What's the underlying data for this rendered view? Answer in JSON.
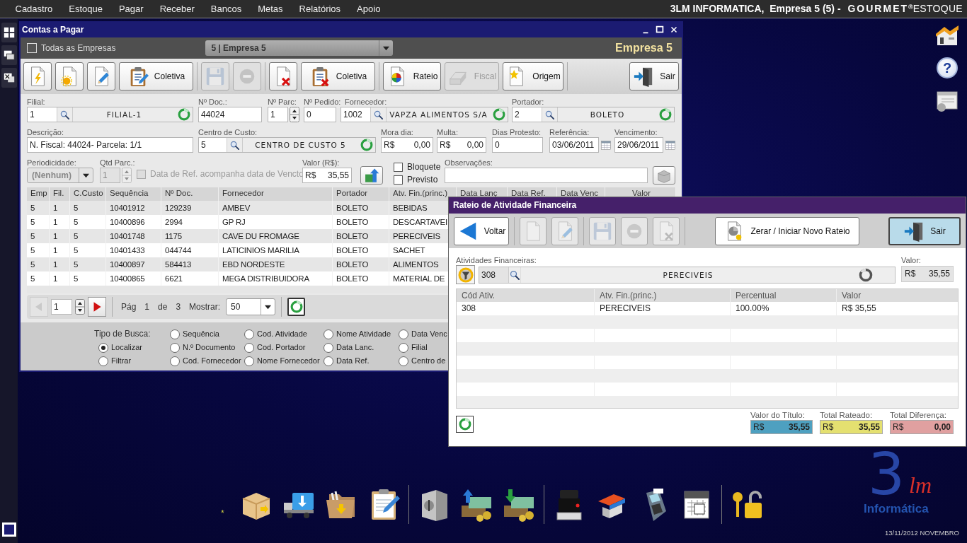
{
  "menu_bar": {
    "items": [
      "Cadastro",
      "Estoque",
      "Pagar",
      "Receber",
      "Bancos",
      "Metas",
      "Relatórios",
      "Apoio"
    ],
    "company": "3LM INFORMATICA,  Empresa 5 (5) - ",
    "product": "GOURMET$^{®}$",
    "module": "ESTOQUE"
  },
  "main_window": {
    "title": "Contas a Pagar",
    "all_companies": {
      "label": "Todas as Empresas",
      "checked": false
    },
    "company_select": "5 | Empresa 5",
    "company_name": "Empresa 5",
    "toolbar": [
      {
        "disabled": false
      },
      {
        "disabled": false
      },
      {
        "disabled": false
      },
      {
        "label": "Coletiva",
        "disabled": false
      },
      {
        "disabled": true
      },
      {
        "disabled": true
      },
      {
        "disabled": false
      },
      {
        "label": "Coletiva",
        "disabled": false
      },
      {
        "label": "Rateio",
        "disabled": false
      },
      {
        "label": "Fiscal",
        "disabled": true
      },
      {
        "label": "Origem",
        "disabled": false
      },
      {
        "label": "Sair",
        "disabled": false
      }
    ],
    "form": {
      "filial": {
        "label": "Filial:",
        "code": "1",
        "name": "FILIAL-1"
      },
      "doc": {
        "label": "Nº Doc.:",
        "value": "44024"
      },
      "parcela": {
        "label": "Nº Parc:",
        "value": "1"
      },
      "pedido": {
        "label": "Nº Pedido:",
        "value": "0"
      },
      "fornecedor": {
        "label": "Fornecedor:",
        "code": "1002",
        "name": "VAPZA ALIMENTOS S/A"
      },
      "portador": {
        "label": "Portador:",
        "code": "2",
        "name": "BOLETO"
      },
      "descricao": {
        "label": "Descrição:",
        "value": "N. Fiscal: 44024- Parcela: 1/1"
      },
      "centro_custo": {
        "label": "Centro de Custo:",
        "code": "5",
        "name": "CENTRO DE CUSTO 5"
      },
      "mora": {
        "label": "Mora dia:",
        "currency": "R$",
        "value": "0,00"
      },
      "multa": {
        "label": "Multa:",
        "currency": "R$",
        "value": "0,00"
      },
      "dias_protesto": {
        "label": "Dias Protesto:",
        "value": "0"
      },
      "referencia": {
        "label": "Referência:",
        "value": "03/06/2011"
      },
      "vencimento": {
        "label": "Vencimento:",
        "value": "29/06/2011"
      },
      "periodicidade": {
        "label": "Periodicidade:",
        "value": "(Nenhum)",
        "disabled": true
      },
      "qtd_parc": {
        "label": "Qtd Parc.:",
        "value": "1",
        "disabled": true
      },
      "ref_follows": {
        "label": "Data de Ref. acompanha data de Vencto",
        "checked": false,
        "disabled": true
      },
      "valor": {
        "label": "Valor (R$):",
        "currency": "R$",
        "value": "35,55"
      },
      "bloquete": {
        "label": "Bloquete",
        "checked": false
      },
      "previsto": {
        "label": "Previsto",
        "checked": false
      },
      "observacoes": {
        "label": "Observações:"
      }
    },
    "table": {
      "columns": [
        "Emp",
        "Fil.",
        "C.Custo",
        "Sequência",
        "Nº Doc.",
        "Fornecedor",
        "Portador",
        "Atv. Fin.(princ.)",
        "Data Lanç",
        "Data Ref.",
        "Data Venc",
        "Valor"
      ],
      "rows": [
        [
          "5",
          "1",
          "5",
          "10401912",
          "129239",
          "AMBEV",
          "BOLETO",
          "BEBIDAS"
        ],
        [
          "5",
          "1",
          "5",
          "10400896",
          "2994",
          "GP RJ",
          "BOLETO",
          "DESCARTAVEI"
        ],
        [
          "5",
          "1",
          "5",
          "10401748",
          "1175",
          "CAVE DU FROMAGE",
          "BOLETO",
          "PERECIVEIS"
        ],
        [
          "5",
          "1",
          "5",
          "10401433",
          "044744",
          "LATICINIOS MARILIA",
          "BOLETO",
          "SACHET"
        ],
        [
          "5",
          "1",
          "5",
          "10400897",
          "584413",
          "EBD NORDESTE",
          "BOLETO",
          "ALIMENTOS"
        ],
        [
          "5",
          "1",
          "5",
          "10400865",
          "6621",
          "MEGA DISTRIBUIDORA",
          "BOLETO",
          "MATERIAL DE"
        ]
      ]
    },
    "pager": {
      "prev_disabled": true,
      "page": "1",
      "page_label": "Pág",
      "current": "1",
      "of_label": "de",
      "total": "3",
      "show_label": "Mostrar:",
      "show": "50"
    },
    "search": {
      "title": "Tipo de Busca:",
      "modes": [
        {
          "label": "Localizar",
          "selected": true
        },
        {
          "label": "Filtrar",
          "selected": false
        }
      ],
      "options": [
        {
          "label": "Sequência",
          "selected": false
        },
        {
          "label": "Cod. Atividade",
          "selected": false
        },
        {
          "label": "Nome Atividade",
          "selected": false
        },
        {
          "label": "Data Venc",
          "selected": false
        },
        {
          "label": "N.º Documento",
          "selected": false
        },
        {
          "label": "Cod. Portador",
          "selected": false
        },
        {
          "label": "Data Lanc.",
          "selected": false
        },
        {
          "label": "Filial",
          "selected": false
        },
        {
          "label": "Cod. Fornecedor",
          "selected": false
        },
        {
          "label": "Nome Fornecedor",
          "selected": false
        },
        {
          "label": "Data Ref.",
          "selected": false
        },
        {
          "label": "Centro de",
          "selected": false
        }
      ]
    }
  },
  "dialog": {
    "title": "Rateio de Atividade Financeira",
    "toolbar": [
      {
        "label": "Voltar",
        "disabled": false,
        "focused": false
      },
      {
        "disabled": true,
        "focused": false
      },
      {
        "disabled": true,
        "focused": false
      },
      {
        "disabled": true,
        "focused": false
      },
      {
        "disabled": true,
        "focused": false
      },
      {
        "disabled": true,
        "focused": false
      },
      {
        "label": "Zerar / Iniciar Novo Rateio",
        "disabled": false,
        "focused": false
      },
      {
        "label": "Sair",
        "disabled": false,
        "focused": true
      }
    ],
    "activity": {
      "label": "Atividades Financeiras:",
      "code": "308",
      "name": "PERECIVEIS"
    },
    "value": {
      "label": "Valor:",
      "currency": "R$",
      "amount": "35,55"
    },
    "table": {
      "columns": [
        "Cód Ativ.",
        "Atv. Fin.(princ.)",
        "Percentual",
        "Valor"
      ],
      "rows": [
        [
          "308",
          "PERECIVEIS",
          "100.00%",
          "R$ 35,55"
        ]
      ]
    },
    "totals": [
      {
        "label": "Valor do Título:",
        "currency": "R$",
        "amount": "35,55",
        "color": "#4ea0c0"
      },
      {
        "label": "Total Rateado:",
        "currency": "R$",
        "amount": "35,55",
        "color": "#e4e070"
      },
      {
        "label": "Total Diferença:",
        "currency": "R$",
        "amount": "0,00",
        "color": "#e0a0a0"
      }
    ]
  },
  "desktop": {
    "help_button": "?",
    "dock_marker": "*",
    "logo": {
      "number": "3",
      "letters": "lm",
      "name": "Informática"
    },
    "date": "13/11/2012 NOVEMBRO"
  }
}
